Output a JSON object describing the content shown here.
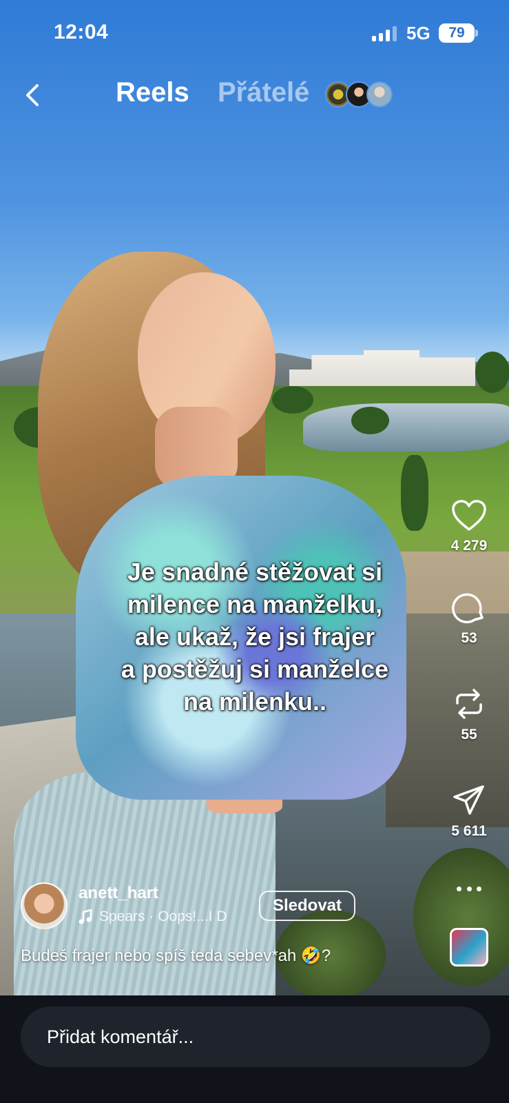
{
  "status_bar": {
    "time": "12:04",
    "network": "5G",
    "battery": "79"
  },
  "header": {
    "tab_reels": "Reels",
    "tab_friends": "Přátelé"
  },
  "overlay_caption": [
    "Je snadné stěžovat si",
    "milence na manželku,",
    "ale ukaž, že jsi frajer",
    "a postěžuj si manželce",
    "na milenku.."
  ],
  "actions": {
    "likes": "4 279",
    "comments": "53",
    "reposts": "55",
    "shares": "5 611"
  },
  "post": {
    "username": "anett_hart",
    "music": "Spears · Oops!...I D",
    "follow_label": "Sledovat",
    "description": "Budeš frajer nebo spíš teda sebev*ah 🤣?"
  },
  "comment_bar": {
    "placeholder": "Přidat komentář..."
  },
  "icons": {
    "back": "chevron-left-icon",
    "like": "heart-icon",
    "comment": "comment-bubble-icon",
    "repost": "repost-icon",
    "share": "paper-plane-icon",
    "more": "more-dots-icon",
    "music": "music-note-icon"
  },
  "colors": {
    "sky_top": "#2f7bd6",
    "bottom_bar": "#10131a",
    "input_bg": "#1f232c"
  }
}
